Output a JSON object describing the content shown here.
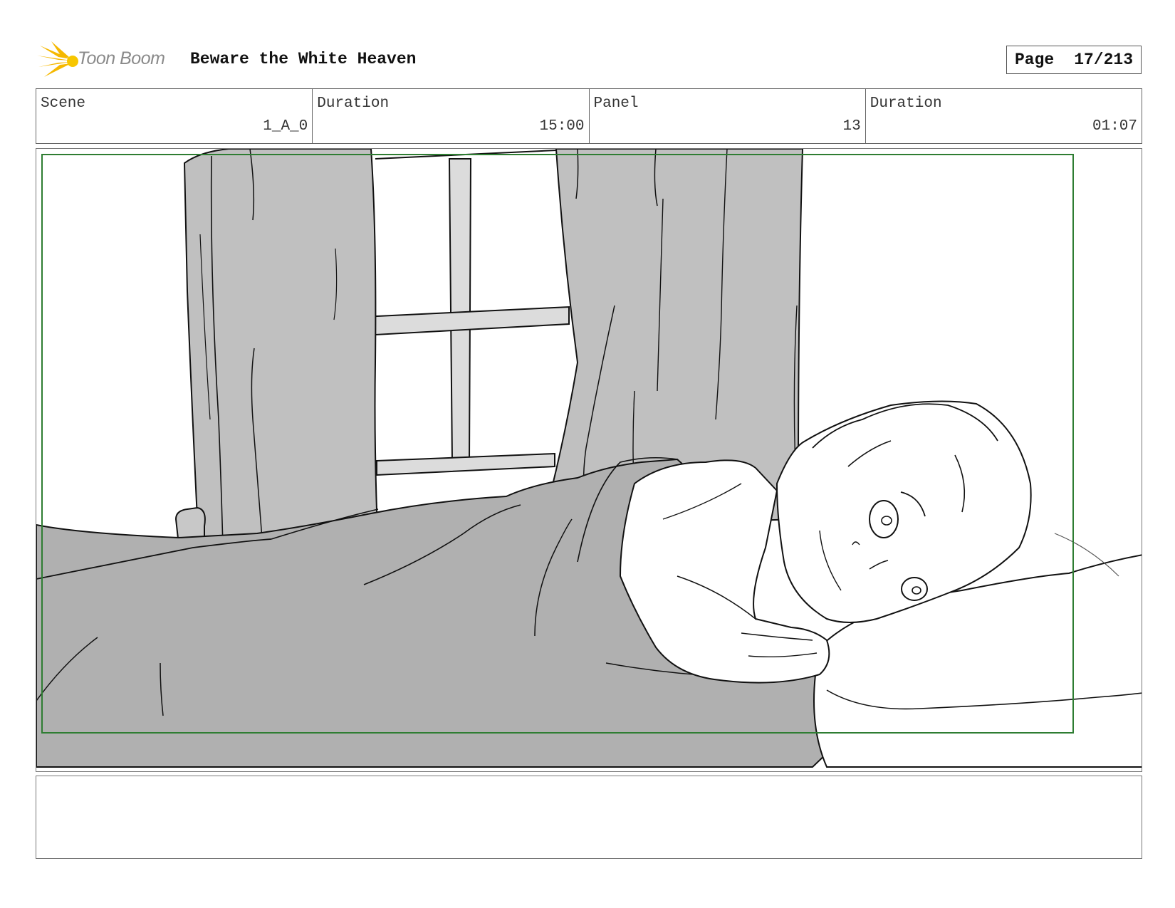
{
  "header": {
    "logo_text": "Toon Boom",
    "project_title": "Beware the White Heaven",
    "page_label": "Page",
    "page_number": "17/213"
  },
  "info": {
    "scene_label": "Scene",
    "scene_value": "1_A_0",
    "scene_duration_label": "Duration",
    "scene_duration_value": "15:00",
    "panel_label": "Panel",
    "panel_value": "13",
    "panel_duration_label": "Duration",
    "panel_duration_value": "01:07"
  },
  "panel": {
    "safe_frame_color": "#2e7d32"
  },
  "notes": {
    "text": ""
  }
}
